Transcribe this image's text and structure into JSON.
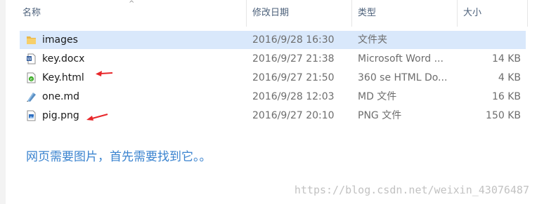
{
  "columns": {
    "name": "名称",
    "date_modified": "修改日期",
    "type": "类型",
    "size": "大小"
  },
  "files": [
    {
      "name": "images",
      "date": "2016/9/28 16:30",
      "type": "文件夹",
      "size": "",
      "icon": "folder-icon",
      "selected": true
    },
    {
      "name": "key.docx",
      "date": "2016/9/27 21:38",
      "type": "Microsoft Word ...",
      "size": "14 KB",
      "icon": "word-document-icon"
    },
    {
      "name": "Key.html",
      "date": "2016/9/27 21:50",
      "type": "360 se HTML Do...",
      "size": "4 KB",
      "icon": "html-file-icon",
      "annotated": true
    },
    {
      "name": "one.md",
      "date": "2016/9/28 12:03",
      "type": "MD 文件",
      "size": "16 KB",
      "icon": "markdown-file-icon"
    },
    {
      "name": "pig.png",
      "date": "2016/9/27 20:10",
      "type": "PNG 文件",
      "size": "150 KB",
      "icon": "image-file-icon",
      "annotated": true
    }
  ],
  "note": "网页需要图片，首先需要找到它。。",
  "watermark": "https://blog.csdn.net/weixin_43076487",
  "colors": {
    "selection": "#d9e8fb",
    "annotation_arrow": "#e8272a",
    "note_text": "#3a83cf"
  }
}
